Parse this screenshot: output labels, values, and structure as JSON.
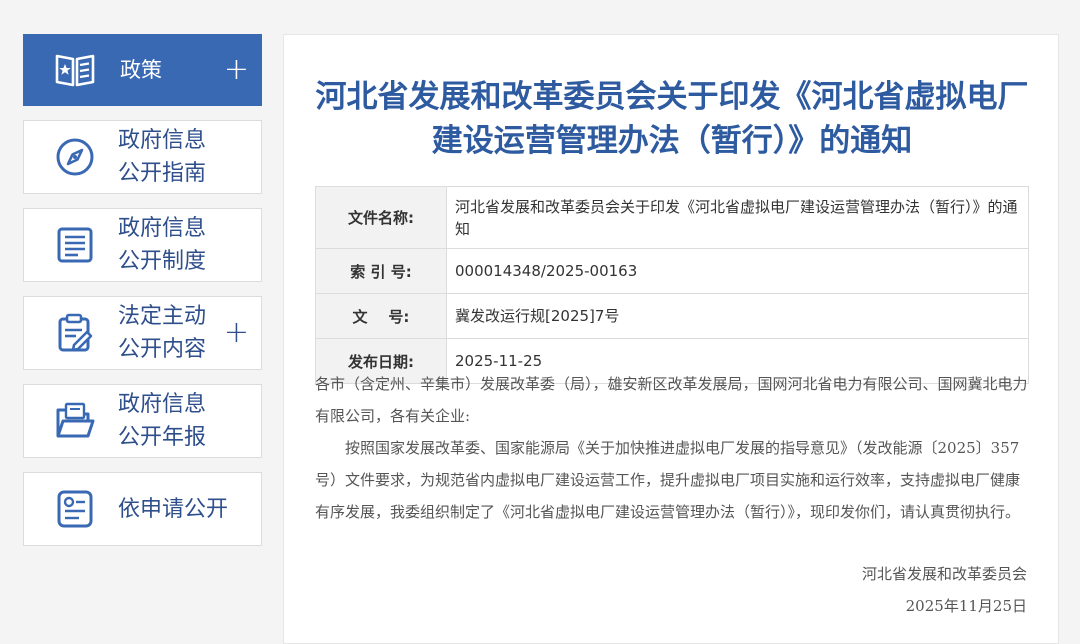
{
  "sidebar": {
    "items": [
      {
        "line1": "政策",
        "line2": "",
        "icon": "policy-book-icon",
        "plus": "+"
      },
      {
        "line1": "政府信息",
        "line2": "公开指南",
        "icon": "compass-icon",
        "plus": ""
      },
      {
        "line1": "政府信息",
        "line2": "公开制度",
        "icon": "list-document-icon",
        "plus": ""
      },
      {
        "line1": "法定主动",
        "line2": "公开内容",
        "icon": "clipboard-edit-icon",
        "plus": "+"
      },
      {
        "line1": "政府信息",
        "line2": "公开年报",
        "icon": "folder-report-icon",
        "plus": ""
      },
      {
        "line1": "依申请公开",
        "line2": "",
        "icon": "application-form-icon",
        "plus": ""
      }
    ]
  },
  "doc": {
    "title_line1": "河北省发展和改革委员会关于印发《河北省虚拟电厂",
    "title_line2": "建设运营管理办法（暂行）》的通知",
    "meta": [
      {
        "key": "文件名称:",
        "value": "河北省发展和改革委员会关于印发《河北省虚拟电厂建设运营管理办法（暂行）》的通知"
      },
      {
        "key": "索 引 号:",
        "value": "000014348/2025-00163"
      },
      {
        "key": "文    号:",
        "value": "冀发改运行规[2025]7号"
      },
      {
        "key": "发布日期:",
        "value": "2025-11-25"
      }
    ],
    "para1": "各市（含定州、辛集市）发展改革委（局），雄安新区改革发展局，国网河北省电力有限公司、国网冀北电力有限公司，各有关企业:",
    "para2": "按照国家发展改革委、国家能源局《关于加快推进虚拟电厂发展的指导意见》（发改能源〔2025〕357号）文件要求，为规范省内虚拟电厂建设运营工作，提升虚拟电厂项目实施和运行效率，支持虚拟电厂健康有序发展，我委组织制定了《河北省虚拟电厂建设运营管理办法（暂行）》，现印发你们，请认真贯彻执行。",
    "signature": "河北省发展和改革委员会",
    "date": "2025年11月25日"
  },
  "colors": {
    "accent": "#3a69b4",
    "title": "#2e5aa0",
    "nav_text": "#2e4f8c"
  }
}
